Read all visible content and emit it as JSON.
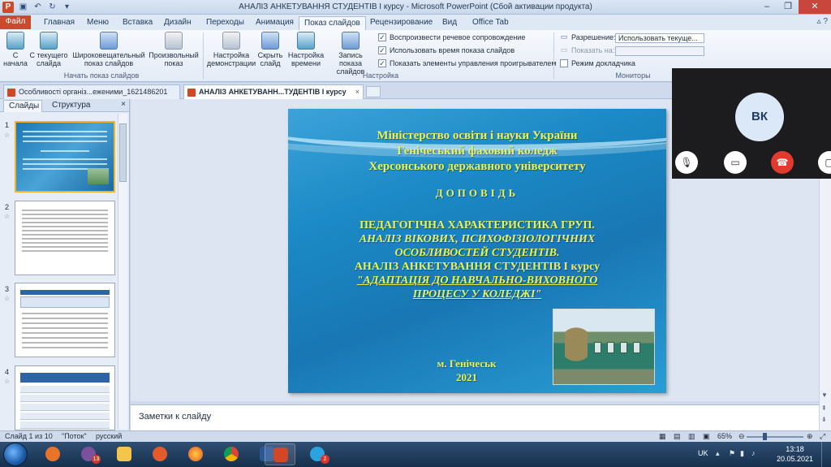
{
  "titlebar": {
    "title": "АНАЛІЗ АНКЕТУВАННЯ СТУДЕНТІВ І курсу  -  Microsoft PowerPoint (Сбой активации продукта)",
    "logo": "P"
  },
  "ribbon_tabs": [
    "Файл",
    "Главная",
    "Меню",
    "Вставка",
    "Дизайн",
    "Переходы",
    "Анимация",
    "Показ слайдов",
    "Рецензирование",
    "Вид",
    "Office Tab"
  ],
  "ribbon": {
    "btn_from_start": "С начала",
    "btn_from_current": "С текущего слайда",
    "btn_broadcast": "Широковещательный показ слайдов",
    "btn_custom": "Произвольный показ",
    "group_start": "Начать показ слайдов",
    "btn_setup": "Настройка демонстрации",
    "btn_hide": "Скрыть слайд",
    "btn_timings": "Настройка времени",
    "btn_record": "Запись показа слайдов",
    "group_setup": "Настройка",
    "chk_narration": "Воспроизвести речевое сопровождение",
    "chk_timings": "Использовать время показа слайдов",
    "chk_media": "Показать элементы управления проигрывателем",
    "lbl_resolution": "Разрешение:",
    "val_resolution": "Использовать текуще...",
    "lbl_showon": "Показать на:",
    "chk_presenter": "Режим докладчика",
    "group_monitors": "Мониторы"
  },
  "doctabs": {
    "tab1": "Особливості організ...еженими_1621486201",
    "tab2": "АНАЛІЗ АНКЕТУВАНН...ТУДЕНТІВ І курсу"
  },
  "panel": {
    "tab_slides": "Слайды",
    "tab_outline": "Структура",
    "close": "×",
    "nums": [
      "1",
      "2",
      "3",
      "4"
    ]
  },
  "slide": {
    "line1": "Міністерство освіти і науки України",
    "line2": "Генічеський фаховий коледж",
    "line3": "Херсонського державного університету",
    "report": "ДОПОВІДЬ",
    "t1": "ПЕДАГОГІЧНА ХАРАКТЕРИСТИКА ГРУП.",
    "t2": "АНАЛІЗ ВІКОВИХ, ПСИХОФІЗІОЛОГІЧНИХ",
    "t3": "ОСОБЛИВОСТЕЙ СТУДЕНТІВ.",
    "t4": "АНАЛІЗ АНКЕТУВАННЯ СТУДЕНТІВ І курсу",
    "t5": "\"АДАПТАЦІЯ ДО НАВЧАЛЬНО-ВИХОВНОГО",
    "t6": "ПРОЦЕСУ У КОЛЕДЖІ\"",
    "city": "м. Генічеськ",
    "year": "2021"
  },
  "notes": {
    "placeholder": "Заметки к слайду"
  },
  "status": {
    "slide": "Слайд 1 из 10",
    "theme": "\"Поток\"",
    "lang": "русский",
    "zoom": "65%"
  },
  "taskbar": {
    "badge1": "13",
    "badge2": "2",
    "lang": "UK",
    "time": "13:18",
    "date": "20.05.2021"
  },
  "video": {
    "initials": "ВК"
  }
}
